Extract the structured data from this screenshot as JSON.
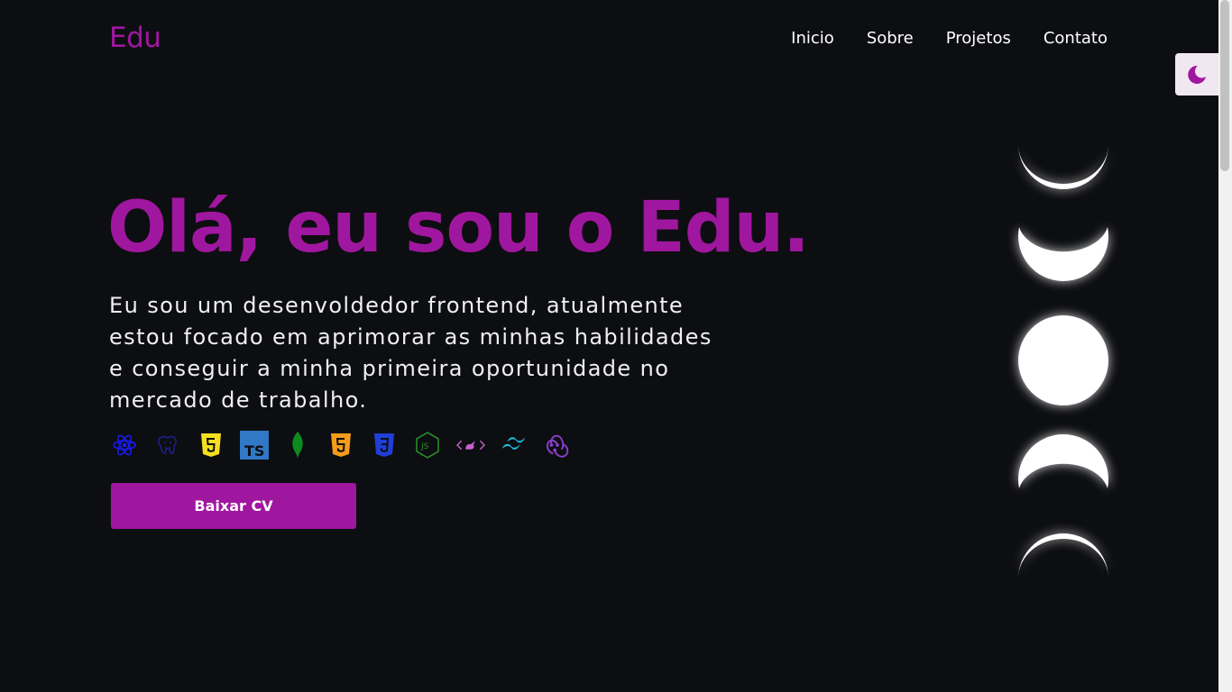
{
  "header": {
    "logo": "Edu",
    "nav": [
      "Inicio",
      "Sobre",
      "Projetos",
      "Contato"
    ]
  },
  "theme_toggle": {
    "icon": "moon-icon",
    "icon_color": "#a0179f"
  },
  "hero": {
    "title": "Olá, eu sou o Edu.",
    "description": "Eu sou um desenvoldedor frontend, atualmente estou focado em aprimorar as minhas habilidades e conseguir a minha primeira oportunidade no mercado de trabalho.",
    "cv_button": "Baixar CV"
  },
  "tech_icons": [
    {
      "name": "react-icon",
      "color": "#1a1aff"
    },
    {
      "name": "postgresql-icon",
      "color": "#1e1e8c"
    },
    {
      "name": "javascript-icon",
      "color": "#f7df1e"
    },
    {
      "name": "typescript-icon",
      "color": "#3178c6"
    },
    {
      "name": "mongodb-icon",
      "color": "#0d8a1f"
    },
    {
      "name": "html5-icon",
      "color": "#f59c1a"
    },
    {
      "name": "css3-icon",
      "color": "#1f3fd6"
    },
    {
      "name": "nodejs-icon",
      "color": "#2a8a2a"
    },
    {
      "name": "code-icon",
      "color": "#c85fd0"
    },
    {
      "name": "tailwind-icon",
      "color": "#22b8d6"
    },
    {
      "name": "redux-icon",
      "color": "#8a3fd0"
    }
  ],
  "moon_phases": [
    "waxing-crescent",
    "waxing-gibbous",
    "full",
    "waning-gibbous",
    "waning-crescent"
  ],
  "colors": {
    "accent": "#a0179f",
    "background": "#0d0e11",
    "text": "#ffffff"
  }
}
